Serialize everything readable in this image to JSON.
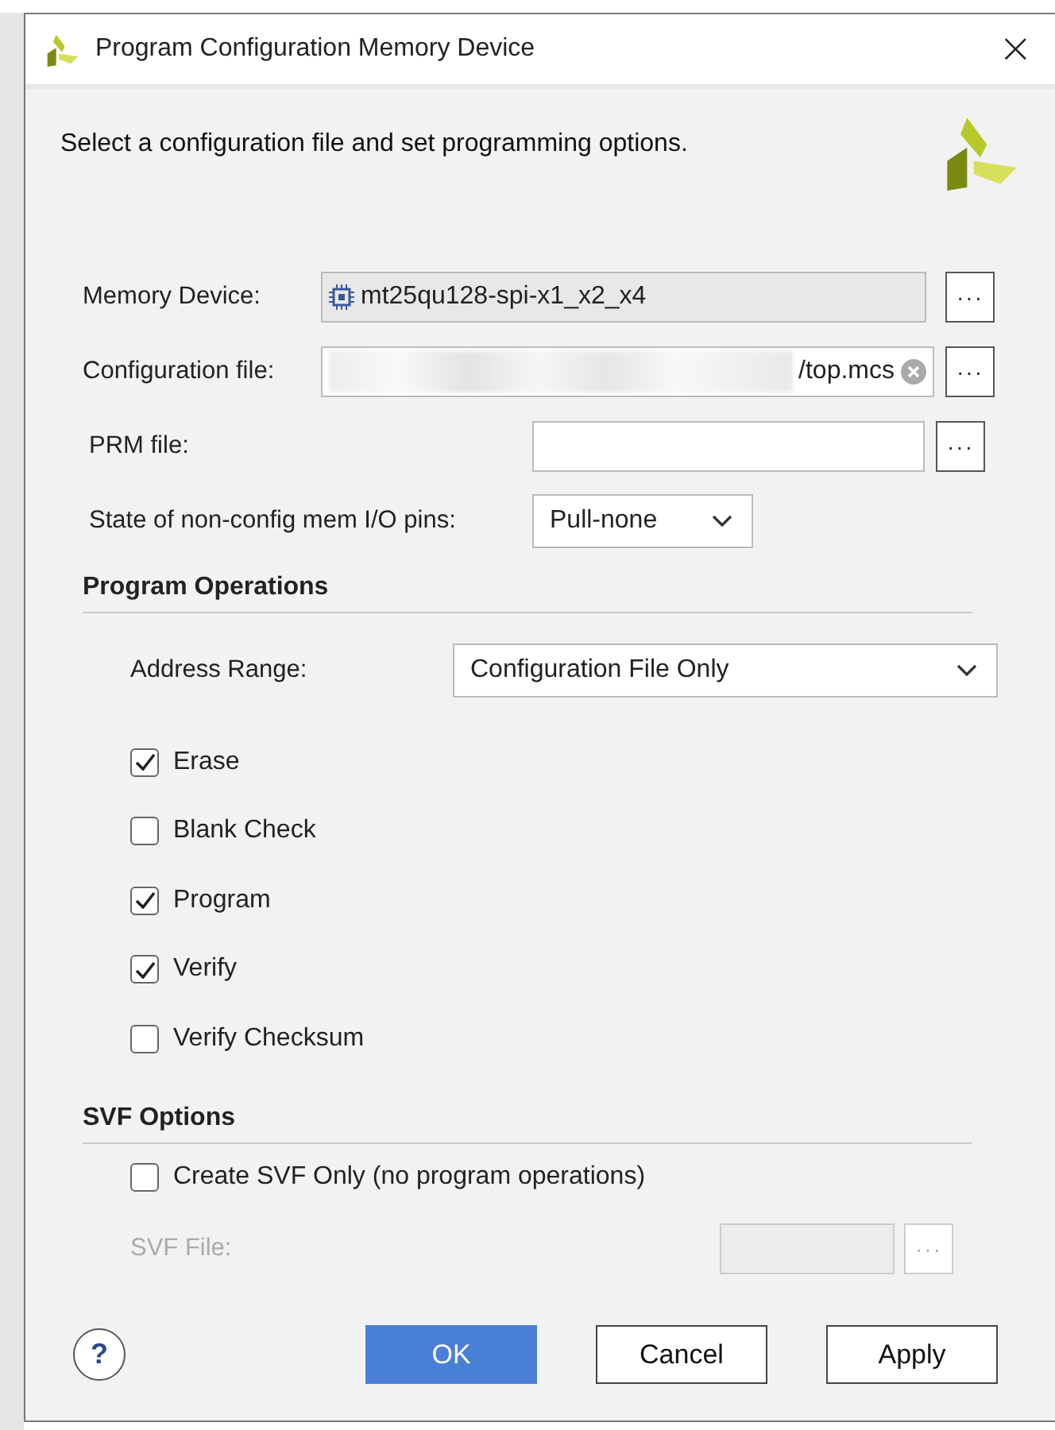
{
  "window": {
    "title": "Program Configuration Memory Device",
    "close": "×"
  },
  "instruction": "Select a configuration file and set programming options.",
  "fields": [
    {
      "kind": "device",
      "label": "Memory Device:",
      "value": "mt25qu128-spi-x1_x2_x4",
      "browse": "···"
    },
    {
      "kind": "file",
      "label": "Configuration file:",
      "value": "/top.mcs",
      "browse": "···"
    },
    {
      "kind": "empty",
      "label": "PRM file:",
      "browse": "···"
    },
    {
      "kind": "combo",
      "label": "State of non-config mem I/O pins:",
      "value": "Pull-none"
    }
  ],
  "program_operations": {
    "title": "Program Operations",
    "address_range": {
      "label": "Address Range:",
      "value": "Configuration File Only"
    },
    "options": [
      {
        "label": "Erase",
        "checked": true
      },
      {
        "label": "Blank Check",
        "checked": false
      },
      {
        "label": "Program",
        "checked": true
      },
      {
        "label": "Verify",
        "checked": true
      },
      {
        "label": "Verify Checksum",
        "checked": false
      }
    ]
  },
  "svf_options": {
    "title": "SVF Options",
    "create_only": {
      "label": "Create SVF Only (no program operations)",
      "checked": false
    },
    "svf_file": {
      "label": "SVF File:",
      "disabled": true,
      "browse": "···"
    }
  },
  "help": "?",
  "buttons": [
    {
      "label": "OK",
      "kind": "primary"
    },
    {
      "label": "Cancel",
      "kind": "normal"
    },
    {
      "label": "Apply",
      "kind": "normal"
    }
  ]
}
